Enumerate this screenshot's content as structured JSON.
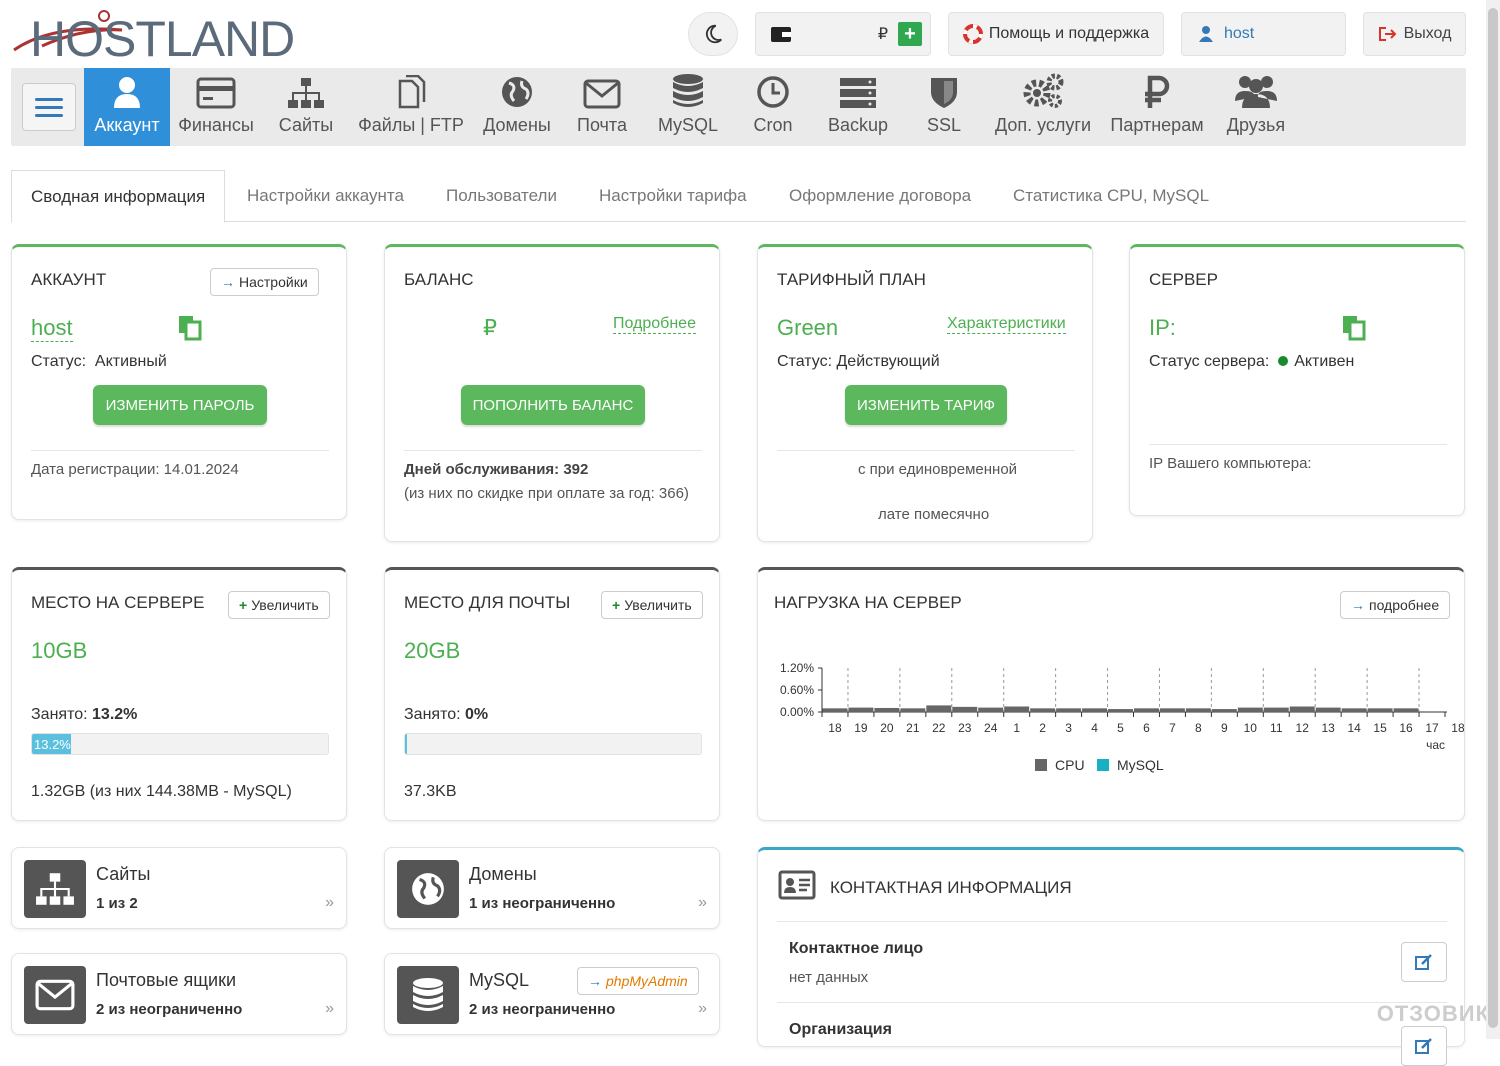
{
  "header": {
    "logo": "HOSTLAND",
    "wallet_currency": "₽",
    "help_label": "Помощь и поддержка",
    "user_label": "host",
    "logout_label": "Выход"
  },
  "nav": {
    "items": [
      {
        "label": "Аккаунт",
        "icon": "user-icon"
      },
      {
        "label": "Финансы",
        "icon": "card-icon"
      },
      {
        "label": "Сайты",
        "icon": "sitemap-icon"
      },
      {
        "label": "Файлы | FTP",
        "icon": "files-icon"
      },
      {
        "label": "Домены",
        "icon": "globe-icon"
      },
      {
        "label": "Почта",
        "icon": "envelope-icon"
      },
      {
        "label": "MySQL",
        "icon": "database-icon"
      },
      {
        "label": "Cron",
        "icon": "clock-icon"
      },
      {
        "label": "Backup",
        "icon": "server-icon"
      },
      {
        "label": "SSL",
        "icon": "shield-icon"
      },
      {
        "label": "Доп. услуги",
        "icon": "gears-icon"
      },
      {
        "label": "Партнерам",
        "icon": "ruble-icon"
      },
      {
        "label": "Друзья",
        "icon": "users-icon"
      }
    ]
  },
  "tabs": [
    "Сводная информация",
    "Настройки аккаунта",
    "Пользователи",
    "Настройки тарифа",
    "Оформление договора",
    "Статистика CPU, MySQL"
  ],
  "account": {
    "title": "АККАУНТ",
    "settings_btn": "Настройки",
    "login": "host",
    "status_label": "Статус:",
    "status_value": "Активный",
    "change_pw_btn": "ИЗМЕНИТЬ ПАРОЛЬ",
    "reg_date": "Дата регистрации: 14.01.2024"
  },
  "balance": {
    "title": "БАЛАНС",
    "currency": "₽",
    "more_link": "Подробнее",
    "topup_btn": "ПОПОЛНИТЬ БАЛАНС",
    "days_label": "Дней обслуживания: 392",
    "days_note": "(из них по скидке при оплате за год: 366)"
  },
  "tariff": {
    "title": "ТАРИФНЫЙ ПЛАН",
    "name": "Green",
    "specs_link": "Характеристики",
    "status": "Статус: Действующий",
    "change_btn": "ИЗМЕНИТЬ ТАРИФ",
    "note1": "с при единовременной",
    "note2": "лате помесячно"
  },
  "server": {
    "title": "СЕРВЕР",
    "ip_label": "IP:",
    "status_label": "Статус сервера:",
    "status_value": "Активен",
    "your_ip": "IP Вашего компьютера:"
  },
  "disk": {
    "title": "МЕСТО НА СЕРВЕРЕ",
    "increase_btn": "Увеличить",
    "size": "10GB",
    "used_label": "Занято:",
    "used_value": "13.2%",
    "used_fraction": 0.132,
    "bar_label": "13.2%",
    "detail": "1.32GB (из них 144.38MB - MySQL)"
  },
  "mail_space": {
    "title": "МЕСТО ДЛЯ ПОЧТЫ",
    "increase_btn": "Увеличить",
    "size": "20GB",
    "used_label": "Занято:",
    "used_value": "0%",
    "used_fraction": 0,
    "detail": "37.3KB"
  },
  "load": {
    "title": "НАГРУЗКА НА СЕРВЕР",
    "more_btn": "подробнее"
  },
  "chart_data": {
    "type": "bar",
    "categories": [
      "18",
      "19",
      "20",
      "21",
      "22",
      "23",
      "24",
      "1",
      "2",
      "3",
      "4",
      "5",
      "6",
      "7",
      "8",
      "9",
      "10",
      "11",
      "12",
      "13",
      "14",
      "15",
      "16",
      "17",
      "18"
    ],
    "series": [
      {
        "name": "CPU",
        "values": [
          0.1,
          0.12,
          0.11,
          0.1,
          0.18,
          0.14,
          0.12,
          0.15,
          0.1,
          0.1,
          0.1,
          0.08,
          0.1,
          0.1,
          0.1,
          0.08,
          0.12,
          0.12,
          0.15,
          0.12,
          0.1,
          0.1,
          0.1,
          0,
          0
        ]
      },
      {
        "name": "MySQL",
        "values": [
          0,
          0,
          0,
          0,
          0,
          0,
          0,
          0,
          0,
          0,
          0,
          0,
          0,
          0,
          0,
          0,
          0,
          0,
          0,
          0,
          0,
          0,
          0,
          0,
          0
        ]
      }
    ],
    "y_ticks": [
      "1.20%",
      "0.60%",
      "0.00%"
    ],
    "ylim": [
      0,
      1.2
    ],
    "xlabel": "час",
    "colors": {
      "CPU": "#666666",
      "MySQL": "#1ab0c4"
    },
    "legend": "bottom"
  },
  "tiles": {
    "sites": {
      "name": "Сайты",
      "count": "1 из 2"
    },
    "domains": {
      "name": "Домены",
      "count": "1 из неограниченно"
    },
    "mailboxes": {
      "name": "Почтовые ящики",
      "count": "2 из неограниченно"
    },
    "mysql": {
      "name": "MySQL",
      "count": "2 из неограниченно",
      "pma_btn": "phpMyAdmin"
    }
  },
  "contact": {
    "title": "КОНТАКТНАЯ ИНФОРМАЦИЯ",
    "person_label": "Контактное лицо",
    "person_value": "нет данных",
    "org_label": "Организация"
  },
  "watermark": "ОТЗОВИК"
}
